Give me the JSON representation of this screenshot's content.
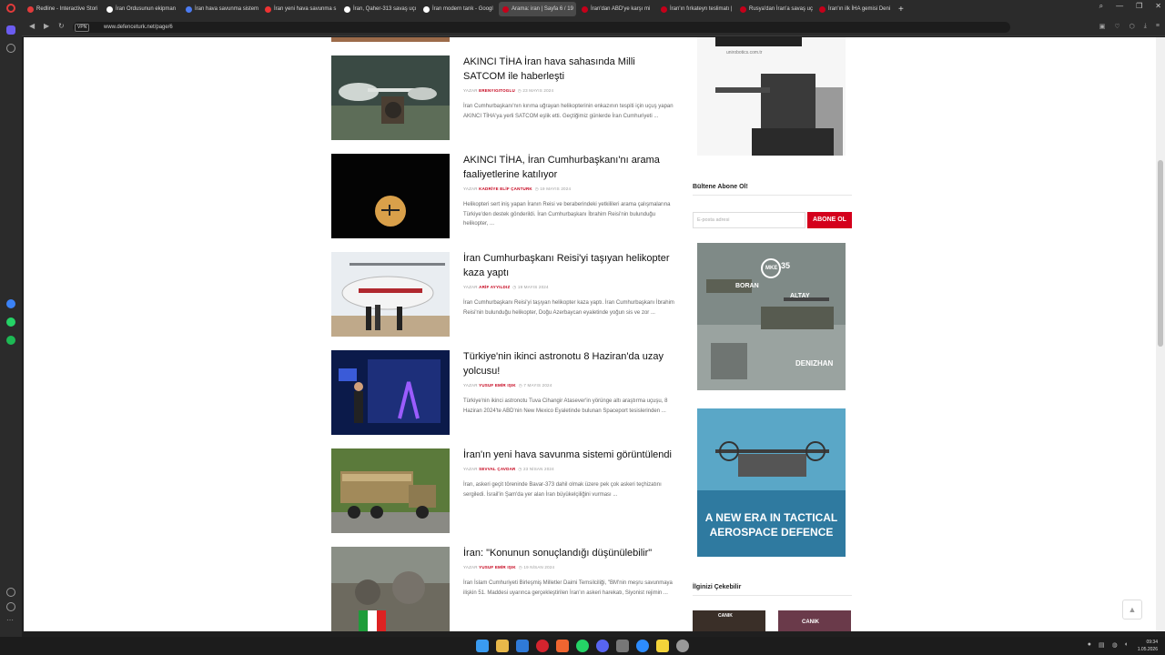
{
  "browser": {
    "tabs": [
      {
        "label": "Redline - Interactive Stori",
        "icon_color": "#e23b3b"
      },
      {
        "label": "İran Ordusunun ekipman",
        "icon_color": "#ffffff"
      },
      {
        "label": "İran hava savunma sistem",
        "icon_color": "#4c7cf3"
      },
      {
        "label": "İran yeni hava savunma s",
        "icon_color": "#e33"
      },
      {
        "label": "İran, Qaher-313 savaş uçı",
        "icon_color": "#ffffff"
      },
      {
        "label": "İran modern tank - Googl",
        "icon_color": "#ffffff"
      },
      {
        "label": "Arama: iran | Sayfa 6 / 19",
        "icon_color": "#c5001a",
        "active": true
      },
      {
        "label": "İran'dan ABD'ye karşı mi",
        "icon_color": "#c5001a"
      },
      {
        "label": "İran'ın fırkateyn teslimatı |",
        "icon_color": "#c5001a"
      },
      {
        "label": "Rusya'dan İran'a savaş uç",
        "icon_color": "#c5001a"
      },
      {
        "label": "İran'ın ilk İHA gemisi Deni",
        "icon_color": "#c5001a"
      }
    ],
    "new_tab_label": "+",
    "url": "www.defenceturk.net/page/6",
    "vpn_label": "VPN"
  },
  "articles": [
    {
      "title": "AKINCI TİHA İran hava sahasında Milli SATCOM ile haberleşti",
      "meta_prefix": "YAZAR",
      "author": "ERENYIGITOGLU",
      "date": "23 MAYIS 2024",
      "excerpt": "İran Cumhurbaşkanı'nın kırıma uğrayan helikopterinin enkazının tespiti için uçuş yapan AKINCI TİHA'ya yerli SATCOM eşlik etti. Geçtiğimiz günlerde İran Cumhuriyeti ..."
    },
    {
      "title": "AKINCI TİHA, İran Cumhurbaşkanı'nı arama faaliyetlerine katılıyor",
      "meta_prefix": "YAZAR",
      "author": "KADRİYE ELİF ÇANTURK",
      "date": "19 MAYIS 2024",
      "excerpt": "Helikopteri sert iniş yapan İranın Reisi ve beraberindeki yetkilileri arama çalışmalarına Türkiye'den destek gönderildi. İran Cumhurbaşkanı İbrahim Reisi'nin bulunduğu helikopter, ..."
    },
    {
      "title": "İran Cumhurbaşkanı Reisi'yi taşıyan helikopter kaza yaptı",
      "meta_prefix": "YAZAR",
      "author": "ARİF AYYILDIZ",
      "date": "19 MAYIS 2024",
      "excerpt": "İran Cumhurbaşkanı Reisi'yi taşıyan helikopter kaza yaptı. İran Cumhurbaşkanı İbrahim Reisi'nin bulunduğu helikopter, Doğu Azerbaycan eyaletinde yoğun sis ve zor ..."
    },
    {
      "title": "Türkiye'nin ikinci astronotu 8 Haziran'da uzay yolcusu!",
      "meta_prefix": "YAZAR",
      "author": "YUSUF EMİR IŞIK",
      "date": "7 MAYIS 2024",
      "excerpt": "Türkiye'nin ikinci astronotu Tuva Cihangir Atasever'in yörünge altı araştırma uçuşu, 8 Haziran 2024'te ABD'nin New Mexico Eyaletinde bulunan Spaceport tesislerinden ..."
    },
    {
      "title": "İran'ın yeni hava savunma sistemi görüntülendi",
      "meta_prefix": "YAZAR",
      "author": "SEVVAL ÇAVDAR",
      "date": "23 NİSAN 2024",
      "excerpt": "İran, askeri geçit töreninde Bavar-373 dahil olmak üzere pek çok askeri teçhizatını sergiledi. İsrail'in Şam'da yer alan İran büyükelçiliğini vurması ..."
    },
    {
      "title": "İran: \"Konunun sonuçlandığı düşünülebilir\"",
      "meta_prefix": "YAZAR",
      "author": "YUSUF EMİR IŞIK",
      "date": "19 NİSAN 2024",
      "excerpt": "İran İslam Cumhuriyeti Birleşmiş Milletler Daimi Temsilciliği, \"BM'nin meşru savunmaya ilişkin 51. Maddesi uyarınca gerçekleştirilen İran'ın askeri harekatı, Siyonist rejimin ..."
    }
  ],
  "sidebar": {
    "ad1_url": "unirobotics.com.tr",
    "newsletter_title": "Bültene Abone Ol!",
    "email_placeholder": "E-posta adresi",
    "subscribe_label": "ABONE OL",
    "ad2": {
      "brand": "MKE",
      "years": "35",
      "label1": "BORAN",
      "label2": "ALTAY",
      "label3": "DENIZHAN"
    },
    "ad3": {
      "text": "A NEW ERA IN TACTICAL AEROSPACE DEFENCE"
    },
    "related_title": "İlginizi Çekebilir",
    "related1": "CANIK",
    "related2": "CANIK"
  },
  "taskbar": {
    "time": "09:34",
    "date": "1.05.2026"
  }
}
